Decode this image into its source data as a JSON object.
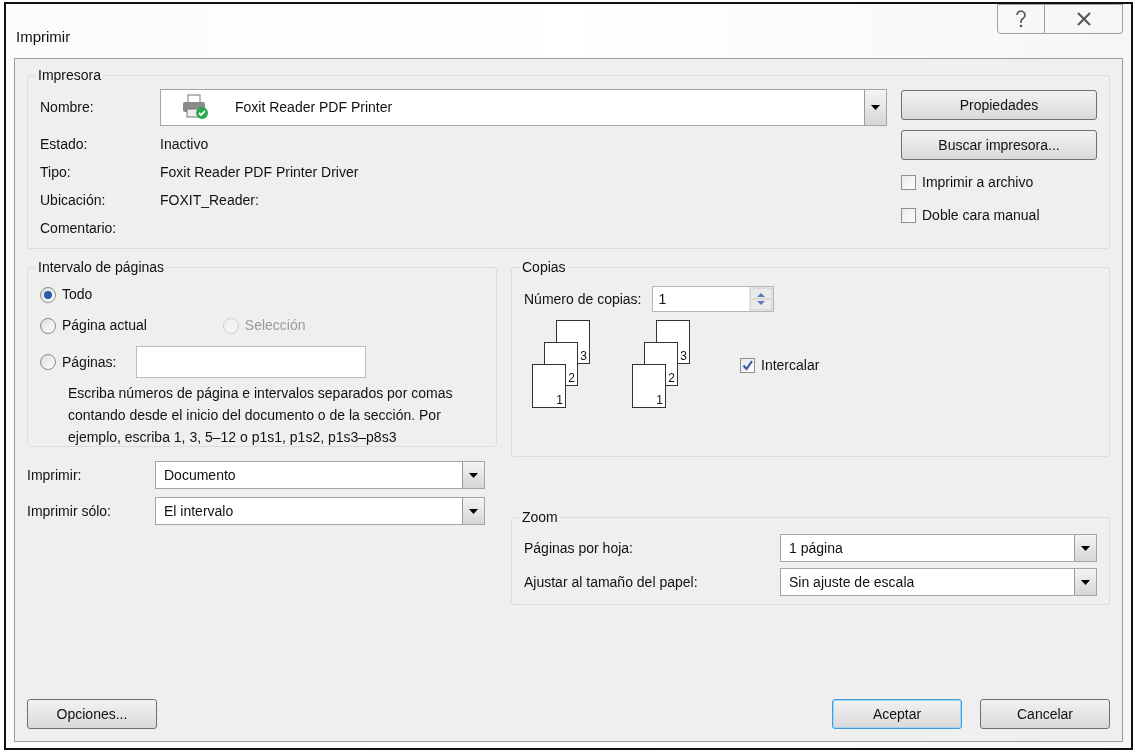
{
  "window": {
    "title": "Imprimir"
  },
  "printer": {
    "legend": "Impresora",
    "name_label": "Nombre:",
    "name_value": "Foxit Reader PDF Printer",
    "info": [
      {
        "label": "Estado:",
        "value": "Inactivo"
      },
      {
        "label": "Tipo:",
        "value": "Foxit Reader PDF Printer Driver"
      },
      {
        "label": "Ubicación:",
        "value": "FOXIT_Reader:"
      },
      {
        "label": "Comentario:"
      }
    ],
    "buttons": [
      "Propiedades",
      "Buscar impresora..."
    ],
    "checkboxes": [
      {
        "label": "Imprimir a archivo",
        "checked": false
      },
      {
        "label": "Doble cara manual",
        "checked": false
      }
    ]
  },
  "page_range": {
    "legend": "Intervalo de páginas",
    "options": [
      {
        "label": "Todo",
        "selected": true,
        "disabled": false
      },
      {
        "label": "Página actual",
        "selected": false,
        "disabled": false
      },
      {
        "label": "Selección",
        "selected": false,
        "disabled": true
      },
      {
        "label": "Páginas:",
        "selected": false,
        "disabled": false
      }
    ],
    "hint": "Escriba números de página e intervalos separados por comas contando desde el inicio del documento o de la sección. Por ejemplo, escriba 1, 3, 5–12 o p1s1, p1s2, p1s3–p8s3"
  },
  "copies": {
    "legend": "Copias",
    "count_label": "Número de copias:",
    "count_value": "1",
    "stacks": [
      [
        "3",
        "2",
        "1"
      ],
      [
        "3",
        "2",
        "1"
      ]
    ],
    "collate": {
      "label": "Intercalar",
      "checked": true
    }
  },
  "print_selects": [
    {
      "label": "Imprimir:",
      "value": "Documento"
    },
    {
      "label": "Imprimir sólo:",
      "value": "El intervalo"
    }
  ],
  "zoom": {
    "legend": "Zoom",
    "selects": [
      {
        "label": "Páginas por hoja:",
        "value": "1 página"
      },
      {
        "label": "Ajustar al tamaño del papel:",
        "value": "Sin ajuste de escala"
      }
    ]
  },
  "footer": {
    "options_button": "Opciones...",
    "buttons": [
      {
        "label": "Aceptar",
        "selected": true
      },
      {
        "label": "Cancelar",
        "selected": false
      }
    ]
  }
}
